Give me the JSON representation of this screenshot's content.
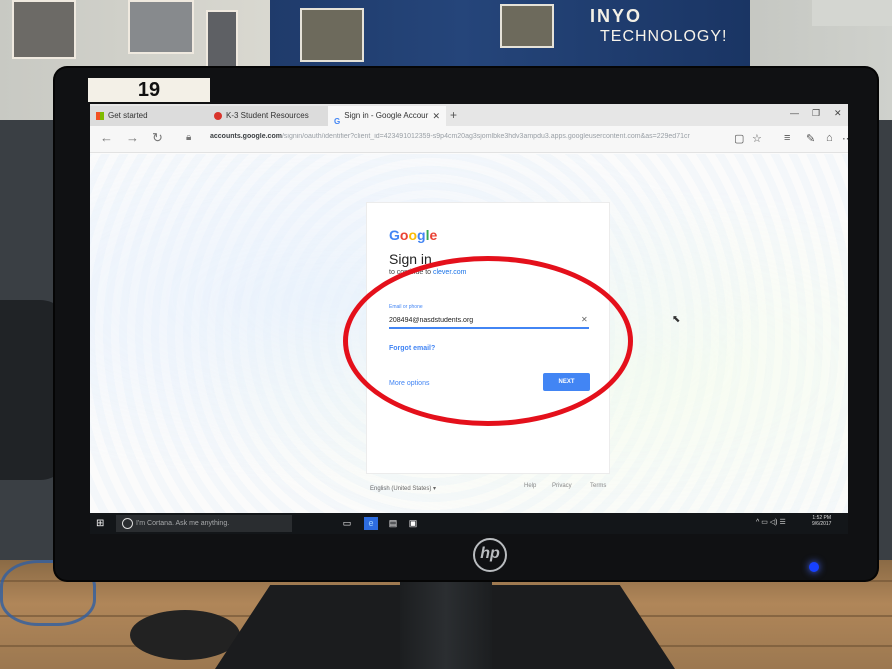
{
  "monitor": {
    "asset_label": "19",
    "brand": "hp"
  },
  "bulletin_board": {
    "sign_top": "INYO",
    "sign_bottom": "TECHNOLOGY!"
  },
  "browser": {
    "tabs": [
      {
        "label": "Get started"
      },
      {
        "label": "K-3 Student Resources"
      },
      {
        "label": "Sign in - Google Accour",
        "active": true
      }
    ],
    "new_tab_symbol": "+",
    "url_domain": "accounts.google.com",
    "url_path": "/signin/oauth/identifier?client_id=423491012359-s9p4cm20ag3sjomlbke3hdv3ampdu3.apps.googleusercontent.com&as=229ed71cr"
  },
  "signin": {
    "logo": "Google",
    "title": "Sign in",
    "subtitle_prefix": "to continue to",
    "subtitle_link": "clever.com",
    "field_label": "Email or phone",
    "email_value": "208494@nasdstudents.org",
    "forgot_email": "Forgot email?",
    "more_options": "More options",
    "next_button": "NEXT"
  },
  "footer": {
    "language": "English (United States)",
    "help": "Help",
    "privacy": "Privacy",
    "terms": "Terms"
  },
  "taskbar": {
    "cortana_placeholder": "I'm Cortana. Ask me anything.",
    "time": "1:52 PM",
    "date": "9/6/2017"
  },
  "colors": {
    "google_blue": "#4285f4",
    "annotation_red": "#e4101b"
  }
}
